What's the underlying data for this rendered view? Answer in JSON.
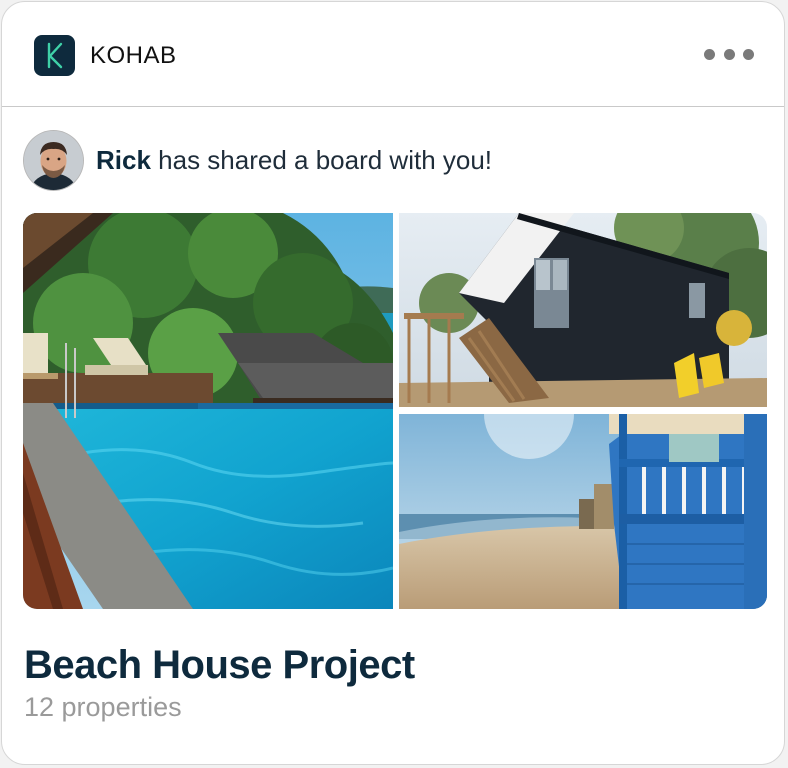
{
  "header": {
    "brand": "KOHAB",
    "logo_letter": "K",
    "menu_icon": "more-horizontal-icon"
  },
  "share": {
    "user": "Rick",
    "message": " has shared a board with you!"
  },
  "board": {
    "title": "Beach House Project",
    "subtitle": "12 properties",
    "images": [
      {
        "subject": "infinity pool overlooking tropical trees and sea"
      },
      {
        "subject": "dark wooden house with steps and yellow chairs"
      },
      {
        "subject": "blue beach hut on sandy beach"
      }
    ]
  },
  "colors": {
    "brand_navy": "#0e2a3d",
    "logo_accent": "#3fd1a8",
    "muted_text": "#9a9a9a"
  }
}
